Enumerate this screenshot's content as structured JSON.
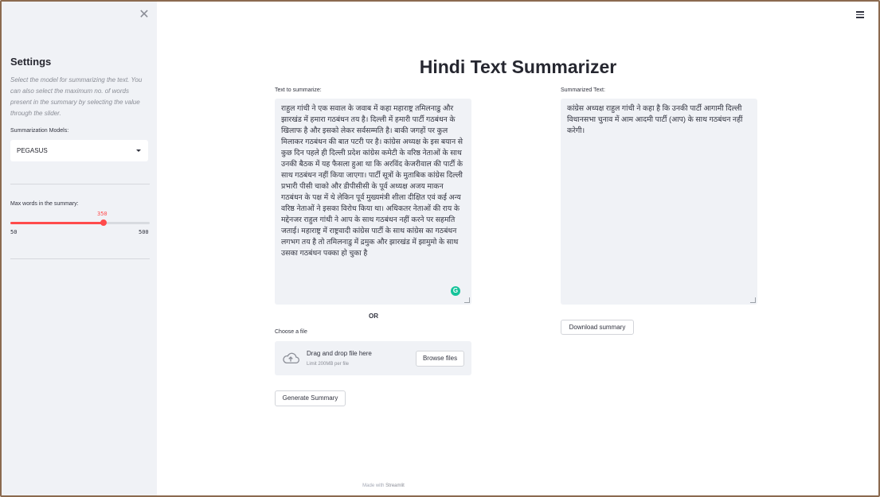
{
  "sidebar": {
    "close_icon": "close-icon",
    "title": "Settings",
    "description": "Select the model for summarizing the text. You can also select the maximum no. of words present in the summary by selecting the value through the slider.",
    "model_label": "Summarization Models:",
    "model_selected": "PEGASUS",
    "slider_label": "Max words in the summary:",
    "slider_value": "350",
    "slider_min": "50",
    "slider_max": "500",
    "slider_fraction": 0.6667,
    "accent_color": "#ff4b4b"
  },
  "header": {
    "menu_icon": "hamburger-menu-icon"
  },
  "main": {
    "title": "Hindi Text Summarizer",
    "input_label": "Text to summarize:",
    "input_text": "राहुल गांधी ने एक सवाल के जवाब में कहा महाराष्ट्र तमिलनाडु और झारखंड में हमारा गठबंधन तय है। दिल्ली में हमारी पार्टी गठबंधन के खिलाफ है और इसको लेकर सर्वसम्मति है। बाकी जगहों पर कुल मिलाकर गठबंधन की बात पटरी पर है। कांग्रेस अध्यक्ष के इस बयान से कुछ दिन पहले ही दिल्ली प्रदेश कांग्रेस कमेटी के वरिष्ठ नेताओं के साथ उनकी बैठक में यह फैसला हुआ था कि अरविंद केजरीवाल की पार्टी के साथ गठबंधन नहीं किया जाएगा। पार्टी सूत्रों के मुताबिक कांग्रेस दिल्ली प्रभारी पीसी चाको और डीपीसीसी के पूर्व अध्यक्ष अजय माकन गठबंधन के पक्ष में थे लेकिन पूर्व मुख्यमंत्री शीला दीक्षित एवं कई अन्य वरिष्ठ नेताओं ने इसका विरोध किया था। अधिकतर नेताओं की राय के मद्देनजर राहुल गांधी ने आप के साथ गठबंधन नहीं करने पर सहमति जताई। महाराष्ट्र में राष्ट्रवादी कांग्रेस पार्टी के साथ कांग्रेस का गठबंधन लगभग तय है तो तमिलनाडु में द्रमुक और झारखंड में झामुमो के साथ उसका गठबंधन पक्का हो चुका है",
    "or_text": "OR",
    "file_label": "Choose a file",
    "dropzone_title": "Drag and drop file here",
    "dropzone_sub": "Limit 200MB per file",
    "browse_label": "Browse files",
    "generate_label": "Generate Summary",
    "output_label": "Summarized Text:",
    "output_text": "कांग्रेस अध्यक्ष राहुल गांधी ने कहा है कि उनकी पार्टी आगामी दिल्ली विधानसभा चुनाव में आम आदमी पार्टी (आप) के साथ गठबंधन नहीं करेगी।",
    "download_label": "Download summary",
    "grammarly_letter": "G"
  },
  "footer": {
    "prefix": "Made with",
    "brand": "Streamlit"
  }
}
